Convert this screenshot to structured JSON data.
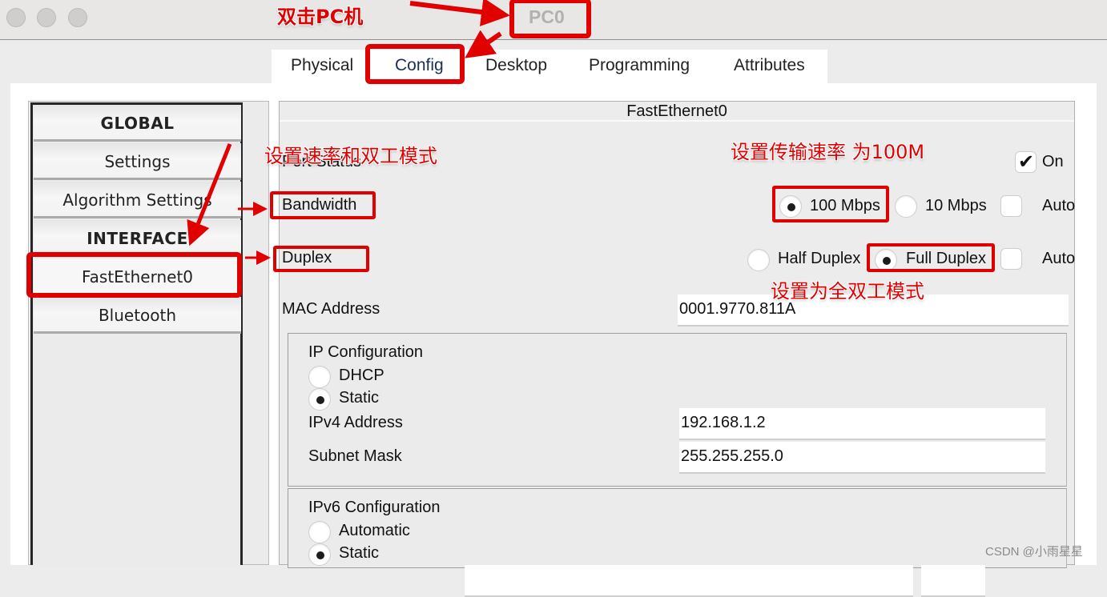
{
  "window": {
    "title": "PC0",
    "traffic_lights": [
      "close-button",
      "minimize-button",
      "maximize-button"
    ]
  },
  "tabs": [
    {
      "label": "Physical",
      "active": false
    },
    {
      "label": "Config",
      "active": true
    },
    {
      "label": "Desktop",
      "active": false
    },
    {
      "label": "Programming",
      "active": false
    },
    {
      "label": "Attributes",
      "active": false
    }
  ],
  "sidebar": {
    "items": [
      {
        "label": "GLOBAL",
        "type": "header"
      },
      {
        "label": "Settings",
        "type": "item"
      },
      {
        "label": "Algorithm Settings",
        "type": "item"
      },
      {
        "label": "INTERFACE",
        "type": "header"
      },
      {
        "label": "FastEthernet0",
        "type": "item",
        "selected": true
      },
      {
        "label": "Bluetooth",
        "type": "item"
      }
    ]
  },
  "panel": {
    "title": "FastEthernet0",
    "port_status": {
      "label": "Port Status",
      "on_label": "On",
      "on_checked": true
    },
    "bandwidth": {
      "label": "Bandwidth",
      "options": [
        {
          "label": "100 Mbps",
          "checked": true
        },
        {
          "label": "10 Mbps",
          "checked": false
        }
      ],
      "auto_label": "Auto",
      "auto_checked": false
    },
    "duplex": {
      "label": "Duplex",
      "options": [
        {
          "label": "Half Duplex",
          "checked": false
        },
        {
          "label": "Full Duplex",
          "checked": true
        }
      ],
      "auto_label": "Auto",
      "auto_checked": false
    },
    "mac": {
      "label": "MAC Address",
      "value": "0001.9770.811A"
    },
    "ip_config": {
      "title": "IP Configuration",
      "options": [
        {
          "label": "DHCP",
          "checked": false
        },
        {
          "label": "Static",
          "checked": true
        }
      ],
      "ipv4": {
        "label": "IPv4 Address",
        "value": "192.168.1.2"
      },
      "subnet": {
        "label": "Subnet Mask",
        "value": "255.255.255.0"
      }
    },
    "ipv6_config": {
      "title": "IPv6 Configuration",
      "options": [
        {
          "label": "Automatic",
          "checked": false
        },
        {
          "label": "Static",
          "checked": true
        }
      ]
    }
  },
  "annotations": {
    "double_click_pc": "双击PC机",
    "set_rate_duplex": "设置速率和双工模式",
    "set_rate_100m": "设置传输速率 为100M",
    "set_full_duplex": "设置为全双工模式",
    "color": "#e00000"
  },
  "watermark": "CSDN @小雨星星"
}
